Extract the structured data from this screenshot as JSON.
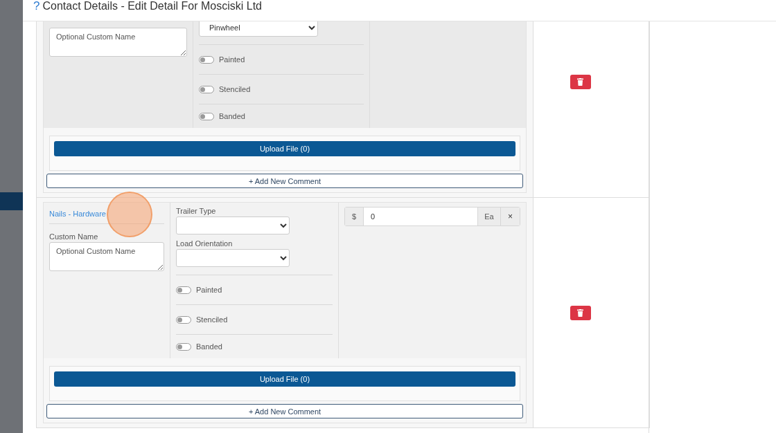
{
  "dialog": {
    "help_icon": "?",
    "title": "Contact Details - Edit Detail For Mosciski Ltd"
  },
  "items": [
    {
      "custom_name": {
        "placeholder": "Optional Custom Name"
      },
      "selects": [
        {
          "value": "Pinwheel"
        }
      ],
      "toggles": [
        {
          "label": "Painted",
          "on": false
        },
        {
          "label": "Stenciled",
          "on": false
        },
        {
          "label": "Banded",
          "on": false
        }
      ],
      "upload_button": "Upload File (0)",
      "comment_button": "+ Add New Comment"
    },
    {
      "product_link": "Nails - Hardware",
      "custom_name": {
        "label": "Custom Name",
        "placeholder": "Optional Custom Name"
      },
      "selects": [
        {
          "label": "Trailer Type"
        },
        {
          "label": "Load Orientation"
        }
      ],
      "price": {
        "currency": "$",
        "value": "0",
        "unit": "Ea",
        "clear": "×"
      },
      "toggles": [
        {
          "label": "Painted",
          "on": false
        },
        {
          "label": "Stenciled",
          "on": false
        },
        {
          "label": "Banded",
          "on": false
        }
      ],
      "upload_button": "Upload File (0)",
      "comment_button": "+ Add New Comment"
    }
  ]
}
